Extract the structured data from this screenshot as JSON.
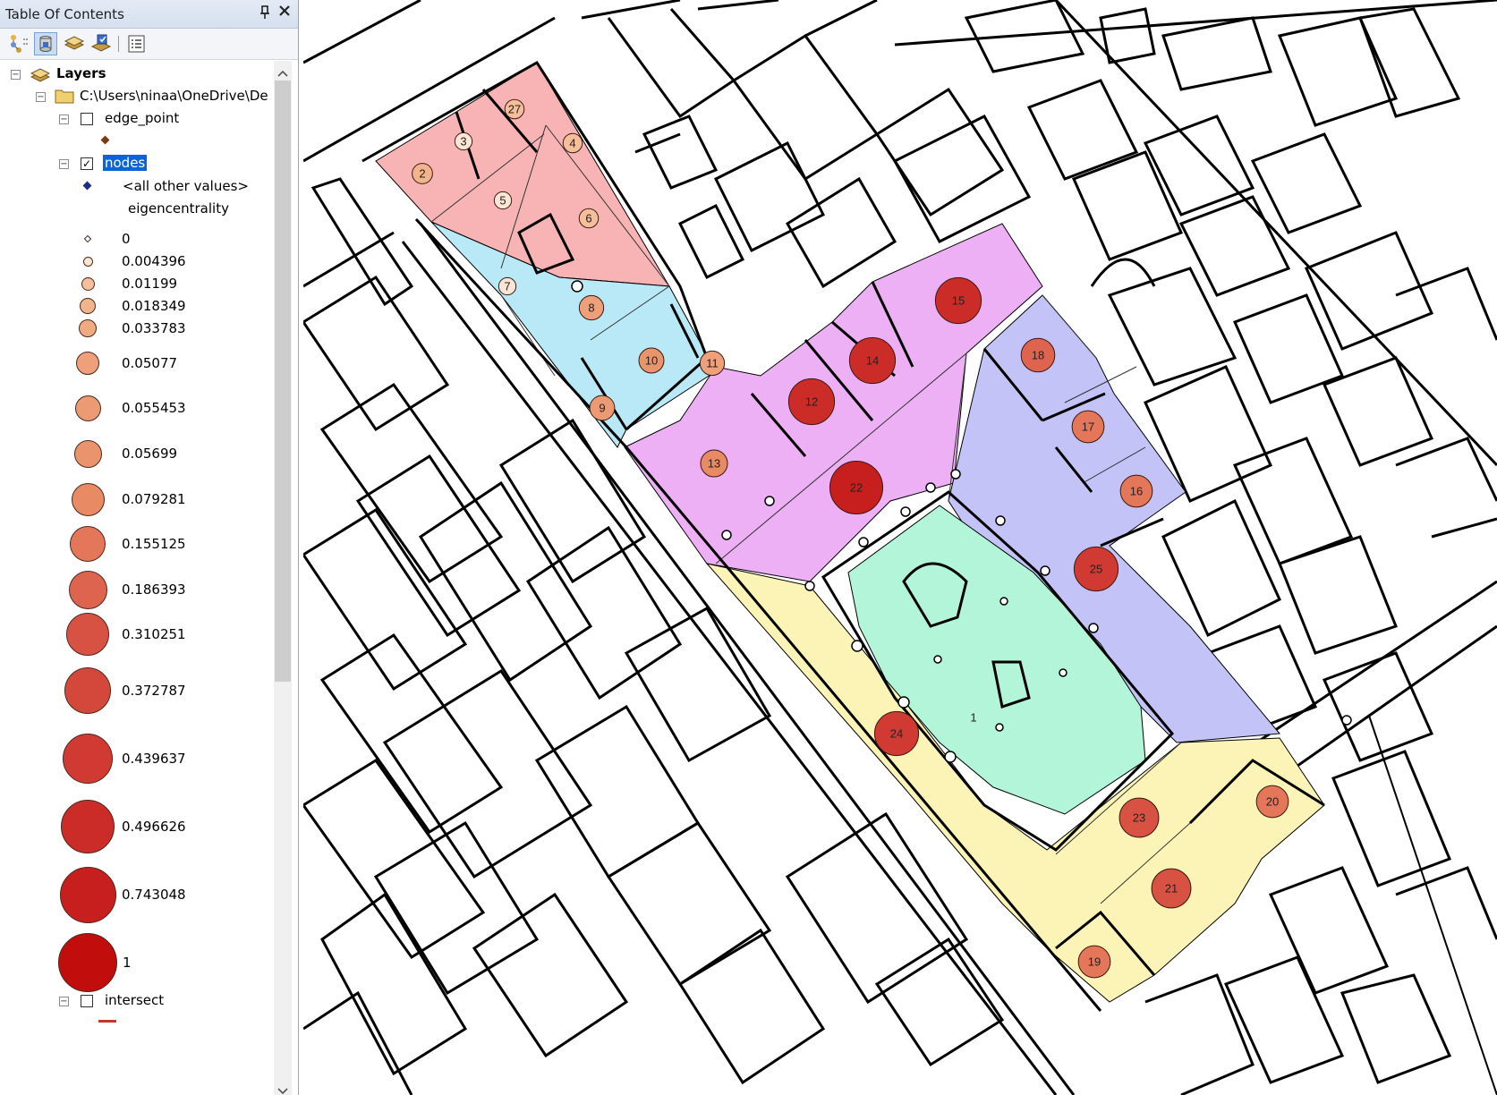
{
  "toc": {
    "title": "Table Of Contents",
    "pin_icon": "pin-icon",
    "close_icon": "close-icon",
    "toolbar": [
      "list-by-drawing-order-icon",
      "list-by-source-icon",
      "list-by-visibility-icon",
      "list-by-selection-icon",
      "options-icon"
    ],
    "layers_label": "Layers",
    "workspace_path": "C:\\Users\\ninaa\\OneDrive\\De",
    "edge_point": {
      "label": "edge_point",
      "checked": false,
      "color": "#7a3c12"
    },
    "nodes": {
      "label": "nodes",
      "checked": true,
      "other_values_label": "<all other values>",
      "other_values_color": "#1e2a8a",
      "field_label": "eigencentrality",
      "legend": [
        {
          "label": "0",
          "color": "#ffffff"
        },
        {
          "label": "0.004396",
          "color": "#fbe6d6"
        },
        {
          "label": "0.01199",
          "color": "#f4bf9a"
        },
        {
          "label": "0.018349",
          "color": "#f2b48c"
        },
        {
          "label": "0.033783",
          "color": "#f0aa80"
        },
        {
          "label": "0.05077",
          "color": "#eea07a"
        },
        {
          "label": "0.055453",
          "color": "#ec9a73"
        },
        {
          "label": "0.05699",
          "color": "#ea946c"
        },
        {
          "label": "0.079281",
          "color": "#e88a63"
        },
        {
          "label": "0.155125",
          "color": "#e4765a"
        },
        {
          "label": "0.186393",
          "color": "#df6450"
        },
        {
          "label": "0.310251",
          "color": "#d85244"
        },
        {
          "label": "0.372787",
          "color": "#d4483c"
        },
        {
          "label": "0.439637",
          "color": "#d03a32"
        },
        {
          "label": "0.496626",
          "color": "#cb2c28"
        },
        {
          "label": "0.743048",
          "color": "#c71e1e"
        },
        {
          "label": "1",
          "color": "#c20d0d"
        }
      ]
    },
    "intersect": {
      "label": "intersect",
      "checked": false
    }
  },
  "map": {
    "zone_colors": {
      "pink": "#f8b4b4",
      "light_blue": "#b9e8f7",
      "magenta": "#eeb0f4",
      "lavender": "#c3c3f7",
      "yellow": "#fbf4b6",
      "mint": "#b3f5d8"
    },
    "nodes": [
      {
        "id": "2",
        "v": 0.018349
      },
      {
        "id": "27",
        "v": 0.01199
      },
      {
        "id": "4",
        "v": 0.01199
      },
      {
        "id": "3",
        "v": 0.004396
      },
      {
        "id": "5",
        "v": 0.004396
      },
      {
        "id": "6",
        "v": 0.01199
      },
      {
        "id": "7",
        "v": 0.004396
      },
      {
        "id": "8",
        "v": 0.05077
      },
      {
        "id": "10",
        "v": 0.05699
      },
      {
        "id": "11",
        "v": 0.05077
      },
      {
        "id": "9",
        "v": 0.055453
      },
      {
        "id": "12",
        "v": 0.496626
      },
      {
        "id": "14",
        "v": 0.496626
      },
      {
        "id": "15",
        "v": 0.496626
      },
      {
        "id": "18",
        "v": 0.186393
      },
      {
        "id": "13",
        "v": 0.079281
      },
      {
        "id": "22",
        "v": 0.743048
      },
      {
        "id": "17",
        "v": 0.155125
      },
      {
        "id": "16",
        "v": 0.155125
      },
      {
        "id": "25",
        "v": 0.439637
      },
      {
        "id": "24",
        "v": 0.439637
      },
      {
        "id": "1",
        "v": 0
      },
      {
        "id": "23",
        "v": 0.310251
      },
      {
        "id": "20",
        "v": 0.155125
      },
      {
        "id": "21",
        "v": 0.310251
      },
      {
        "id": "19",
        "v": 0.155125
      }
    ]
  }
}
